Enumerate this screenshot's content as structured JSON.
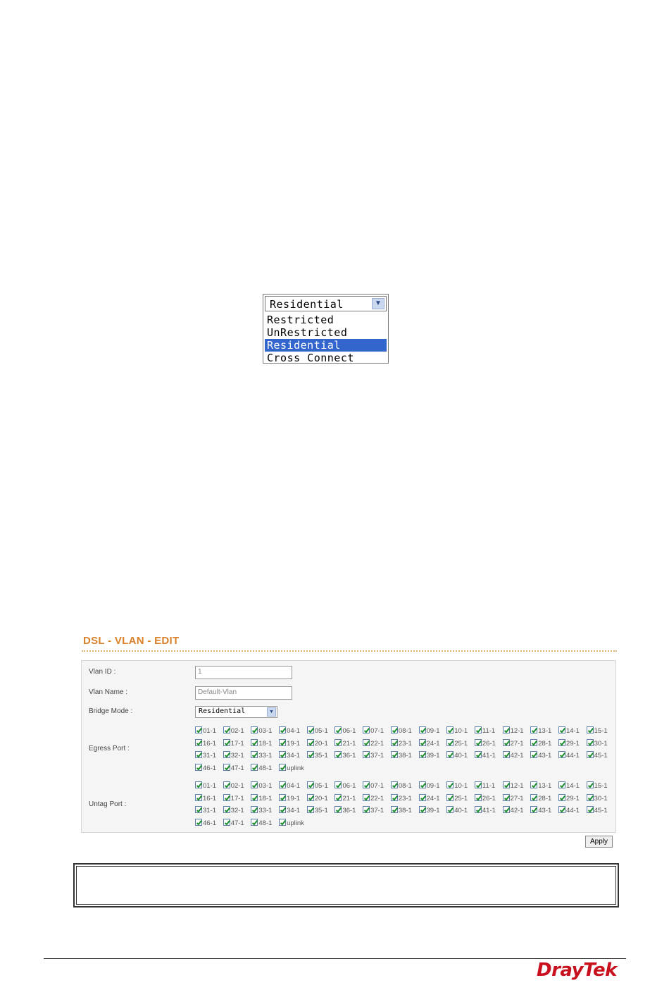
{
  "dropdown_demo": {
    "selected": "Residential",
    "options": [
      "Restricted",
      "UnRestricted",
      "Residential",
      "Cross Connect"
    ],
    "highlighted_index": 2
  },
  "vlan_edit": {
    "title": "DSL - VLAN - EDIT",
    "vlan_id_label": "Vlan ID :",
    "vlan_id_value": "1",
    "vlan_name_label": "Vlan Name :",
    "vlan_name_value": "Default-Vlan",
    "bridge_mode_label": "Bridge Mode :",
    "bridge_mode_value": "Residential",
    "egress_port_label": "Egress Port :",
    "untag_port_label": "Untag Port :",
    "ports": [
      "01-1",
      "02-1",
      "03-1",
      "04-1",
      "05-1",
      "06-1",
      "07-1",
      "08-1",
      "09-1",
      "10-1",
      "11-1",
      "12-1",
      "13-1",
      "14-1",
      "15-1",
      "16-1",
      "17-1",
      "18-1",
      "19-1",
      "20-1",
      "21-1",
      "22-1",
      "23-1",
      "24-1",
      "25-1",
      "26-1",
      "27-1",
      "28-1",
      "29-1",
      "30-1",
      "31-1",
      "32-1",
      "33-1",
      "34-1",
      "35-1",
      "36-1",
      "37-1",
      "38-1",
      "39-1",
      "40-1",
      "41-1",
      "42-1",
      "43-1",
      "44-1",
      "45-1",
      "46-1",
      "47-1",
      "48-1",
      "uplink"
    ],
    "all_checked": true,
    "apply_label": "Apply"
  },
  "footer": {
    "logo_text": "DrayTek",
    "logo_color": "#c8101e"
  },
  "colors": {
    "title_orange": "#d9822b",
    "highlight_blue": "#3266cc",
    "check_green": "#1c8d2c"
  }
}
